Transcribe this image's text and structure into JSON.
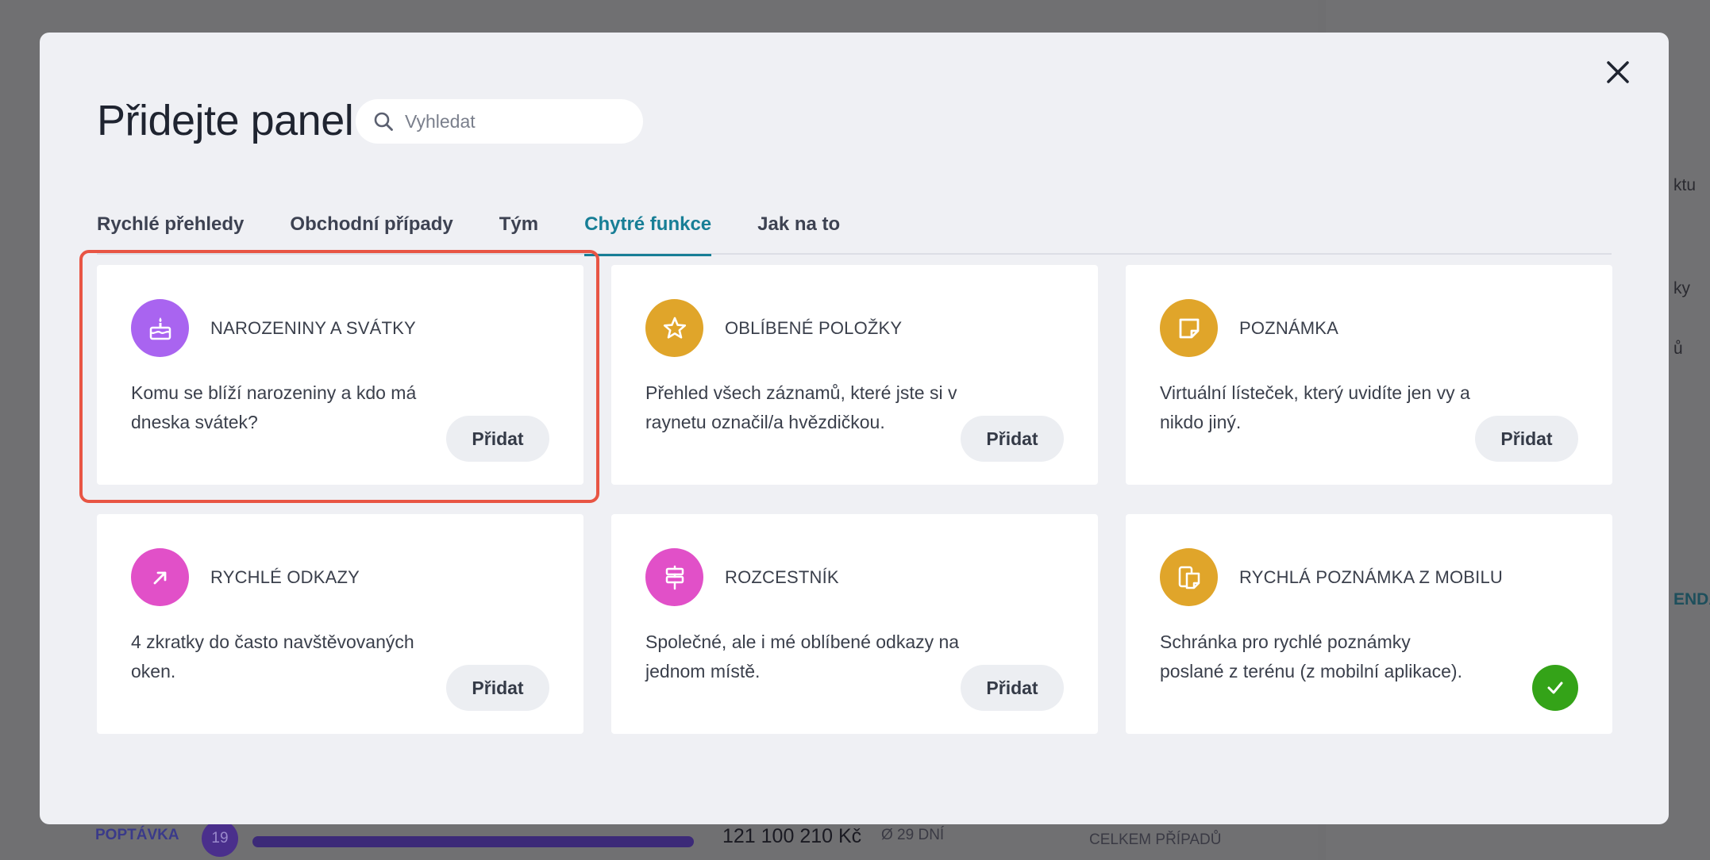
{
  "background": {
    "bottom_label": "POPTÁVKA",
    "bottom_count": "19",
    "bottom_amount": "121 100 210 Kč",
    "bottom_days": "Ø 29 DNÍ",
    "bottom_total": "CELKEM PŘÍPADŮ",
    "side_text_1": "ktu",
    "side_text_2": "ky",
    "side_text_3": "ů",
    "side_text_4": "ENDÁ"
  },
  "modal": {
    "title": "Přidejte panel",
    "search": {
      "placeholder": "Vyhledat"
    },
    "tabs": [
      {
        "label": "Rychlé přehledy"
      },
      {
        "label": "Obchodní případy"
      },
      {
        "label": "Tým"
      },
      {
        "label": "Chytré funkce",
        "active": true
      },
      {
        "label": "Jak na to"
      }
    ],
    "cards": [
      {
        "title": "NAROZENINY A SVÁTKY",
        "description": "Komu se blíží narozeniny a kdo má dneska svátek?",
        "button": "Přidat",
        "icon": "cake-icon",
        "color": "#a964f0"
      },
      {
        "title": "OBLÍBENÉ POLOŽKY",
        "description": "Přehled všech záznamů, které jste si v raynetu označil/a hvězdičkou.",
        "button": "Přidat",
        "icon": "star-icon",
        "color": "#e0a52a"
      },
      {
        "title": "POZNÁMKA",
        "description": "Virtuální lísteček, který uvidíte jen vy a nikdo jiný.",
        "button": "Přidat",
        "icon": "note-icon",
        "color": "#e0a52a"
      },
      {
        "title": "RYCHLÉ ODKAZY",
        "description": "4 zkratky do často navštěvovaných oken.",
        "button": "Přidat",
        "icon": "arrow-up-right-icon",
        "color": "#e150c8"
      },
      {
        "title": "ROZCESTNÍK",
        "description": "Společné, ale i mé oblíbené odkazy na jednom místě.",
        "button": "Přidat",
        "icon": "signpost-icon",
        "color": "#e150c8"
      },
      {
        "title": "RYCHLÁ POZNÁMKA Z MOBILU",
        "description": "Schránka pro rychlé poznámky poslané z terénu (z mobilní aplikace).",
        "added": true,
        "icon": "mobile-note-icon",
        "color": "#e0a52a"
      }
    ]
  }
}
